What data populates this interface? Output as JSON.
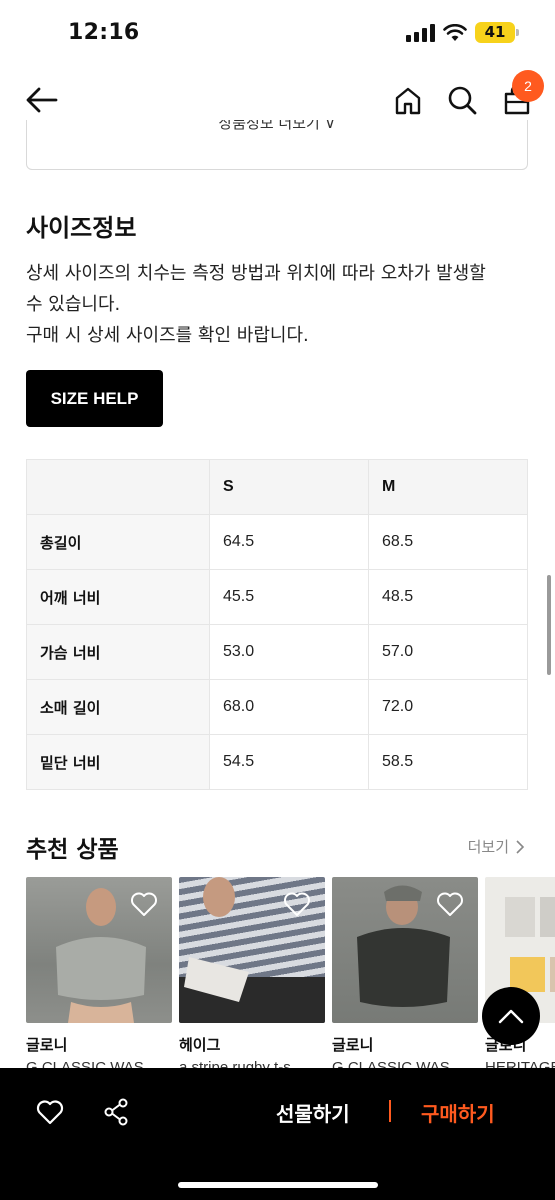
{
  "status_bar": {
    "time": "12:16",
    "battery": "41"
  },
  "header": {
    "cart_count": "2"
  },
  "prev_section": {
    "text": "상품정보 더보기 ∨"
  },
  "size_info": {
    "title": "사이즈정보",
    "description_line1": "상세 사이즈의 치수는 측정 방법과 위치에 따라 오차가 발생할",
    "description_line2": "수 있습니다.",
    "description_line3": "구매 시 상세 사이즈를 확인 바랍니다.",
    "help_button": "SIZE HELP",
    "columns": [
      "S",
      "M"
    ],
    "rows": [
      {
        "label": "총길이",
        "values": [
          "64.5",
          "68.5"
        ]
      },
      {
        "label": "어깨 너비",
        "values": [
          "45.5",
          "48.5"
        ]
      },
      {
        "label": "가슴 너비",
        "values": [
          "53.0",
          "57.0"
        ]
      },
      {
        "label": "소매 길이",
        "values": [
          "68.0",
          "72.0"
        ]
      },
      {
        "label": "밑단 너비",
        "values": [
          "54.5",
          "58.5"
        ]
      }
    ]
  },
  "recommended": {
    "title": "추천 상품",
    "more_label": "더보기",
    "products": [
      {
        "brand": "글로니",
        "name": "G CLASSIC WAS",
        "color": "#8b8e8a"
      },
      {
        "brand": "헤이그",
        "name": "a stripe rugby t-s",
        "color": "#9a9fa6"
      },
      {
        "brand": "글로니",
        "name": "G CLASSIC WAS",
        "color": "#5d5f5c"
      },
      {
        "brand": "글로니",
        "name": "HERITAGE",
        "color": "#e9e7e2"
      }
    ]
  },
  "bottom_bar": {
    "gift_label": "선물하기",
    "buy_label": "구매하기",
    "accent": "#ff5a1f"
  }
}
